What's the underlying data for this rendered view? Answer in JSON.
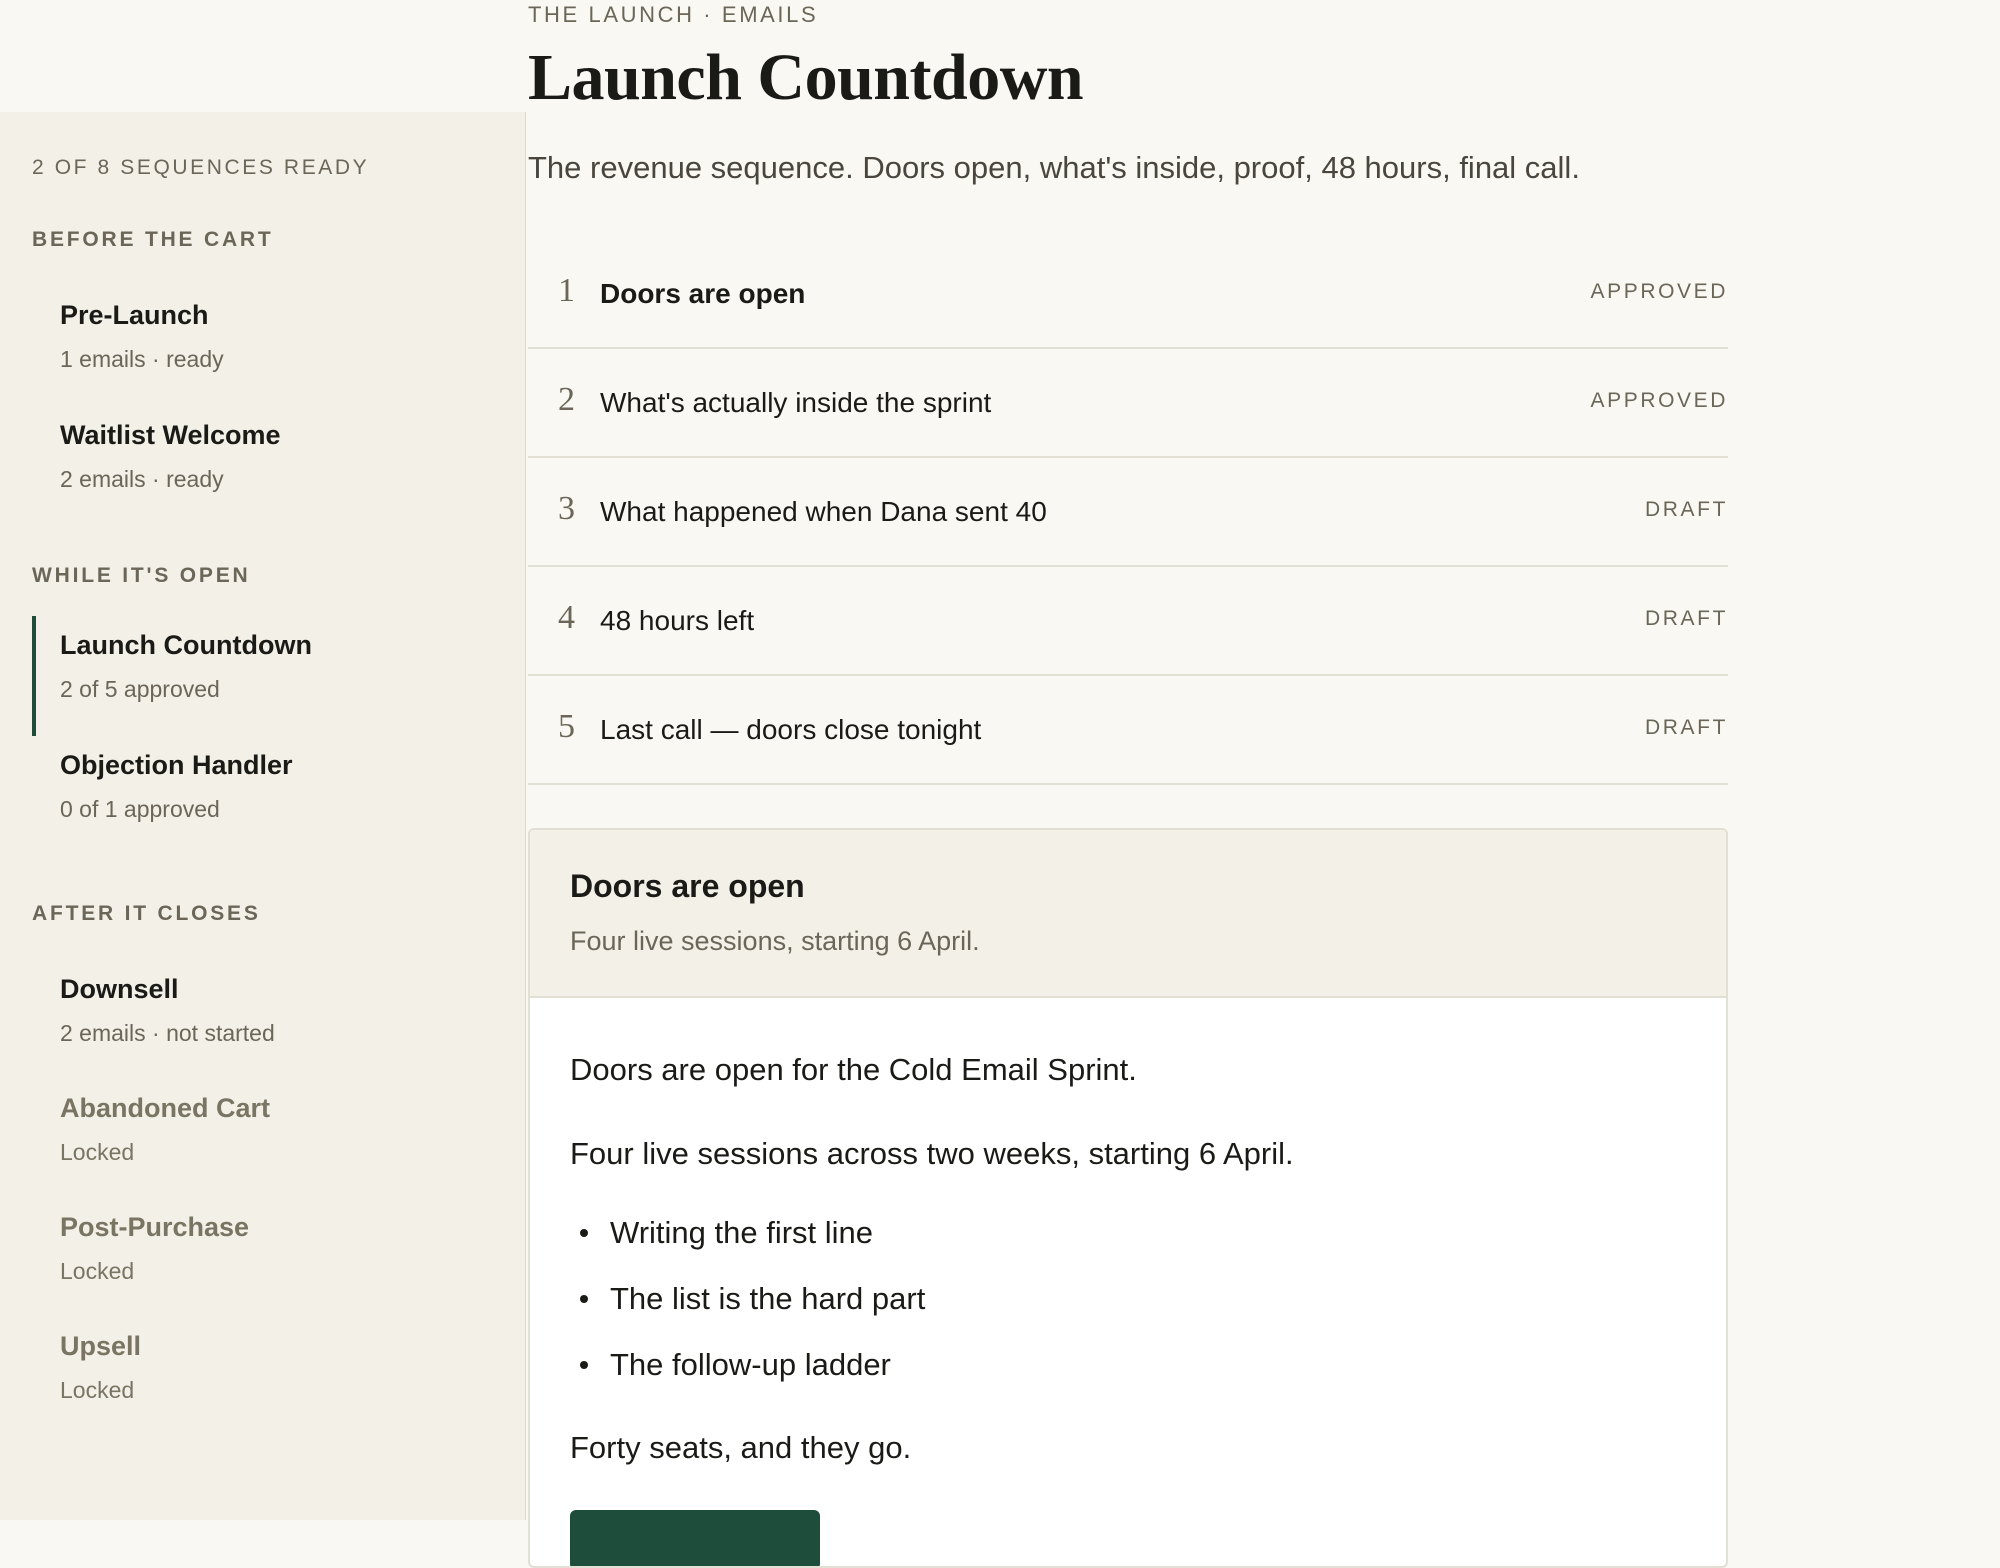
{
  "header": {
    "eyebrow": "THE LAUNCH · EMAILS",
    "title": "Launch Countdown",
    "description": "The revenue sequence. Doors open, what's inside, proof, 48 hours, final call."
  },
  "sidebar": {
    "summary": "2 OF 8 SEQUENCES READY",
    "groups": [
      {
        "label": "BEFORE THE CART",
        "items": [
          {
            "title": "Pre-Launch",
            "sub": "1 emails · ready"
          },
          {
            "title": "Waitlist Welcome",
            "sub": "2 emails · ready"
          }
        ]
      },
      {
        "label": "WHILE IT'S OPEN",
        "items": [
          {
            "title": "Launch Countdown",
            "sub": "2 of 5 approved"
          },
          {
            "title": "Objection Handler",
            "sub": "0 of 1 approved"
          }
        ]
      },
      {
        "label": "AFTER IT CLOSES",
        "items": [
          {
            "title": "Downsell",
            "sub": "2 emails · not started"
          },
          {
            "title": "Abandoned Cart",
            "sub": "Locked"
          },
          {
            "title": "Post-Purchase",
            "sub": "Locked"
          },
          {
            "title": "Upsell",
            "sub": "Locked"
          }
        ]
      }
    ]
  },
  "emails": [
    {
      "num": "1",
      "subject": "Doors are open",
      "status": "APPROVED"
    },
    {
      "num": "2",
      "subject": "What's actually inside the sprint",
      "status": "APPROVED"
    },
    {
      "num": "3",
      "subject": "What happened when Dana sent 40",
      "status": "DRAFT"
    },
    {
      "num": "4",
      "subject": "48 hours left",
      "status": "DRAFT"
    },
    {
      "num": "5",
      "subject": "Last call — doors close tonight",
      "status": "DRAFT"
    }
  ],
  "preview": {
    "subject": "Doors are open",
    "preheader": "Four live sessions, starting 6 April.",
    "body": {
      "p1": "Doors are open for the Cold Email Sprint.",
      "p2": "Four live sessions across two weeks, starting 6 April.",
      "bullets": [
        "Writing the first line",
        "The list is the hard part",
        "The follow-up ladder"
      ],
      "p3": "Forty seats, and they go."
    }
  },
  "colors": {
    "accent": "#1f4d3c",
    "sidebar_bg": "#f2f0e7",
    "page_bg": "#f9f8f3",
    "muted_text": "#6b6658"
  }
}
